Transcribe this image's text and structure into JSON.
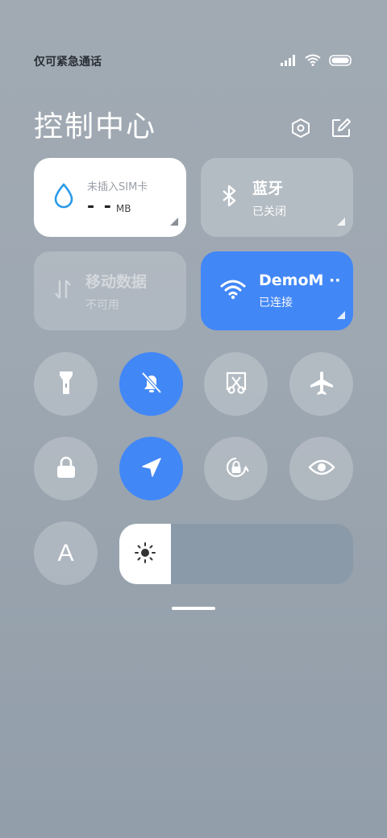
{
  "status_bar": {
    "carrier_text": "仅可紧急通话",
    "icons": [
      "signal-icon",
      "wifi-icon",
      "battery-icon"
    ]
  },
  "header": {
    "title": "控制中心",
    "actions": [
      "settings-icon",
      "edit-icon"
    ]
  },
  "tiles": {
    "data_usage": {
      "line1": "未插入SIM卡",
      "value": "- -",
      "unit": "MB"
    },
    "bluetooth": {
      "label": "蓝牙",
      "status": "已关闭"
    },
    "mobile_data": {
      "label": "移动数据",
      "status": "不可用"
    },
    "wifi": {
      "label": "DemoM ··",
      "status": "已连接"
    }
  },
  "toggles": [
    {
      "name": "flashlight",
      "on": false
    },
    {
      "name": "mute",
      "on": true
    },
    {
      "name": "screenshot",
      "on": false
    },
    {
      "name": "airplane-mode",
      "on": false
    },
    {
      "name": "lock-screen",
      "on": false
    },
    {
      "name": "location",
      "on": true
    },
    {
      "name": "auto-rotate",
      "on": false
    },
    {
      "name": "reading-mode",
      "on": false
    },
    {
      "name": "auto-brightness",
      "on": false,
      "label": "A"
    }
  ],
  "brightness": {
    "level": 0.22
  },
  "colors": {
    "accent": "#4287f6",
    "tile_white": "#ffffff"
  }
}
